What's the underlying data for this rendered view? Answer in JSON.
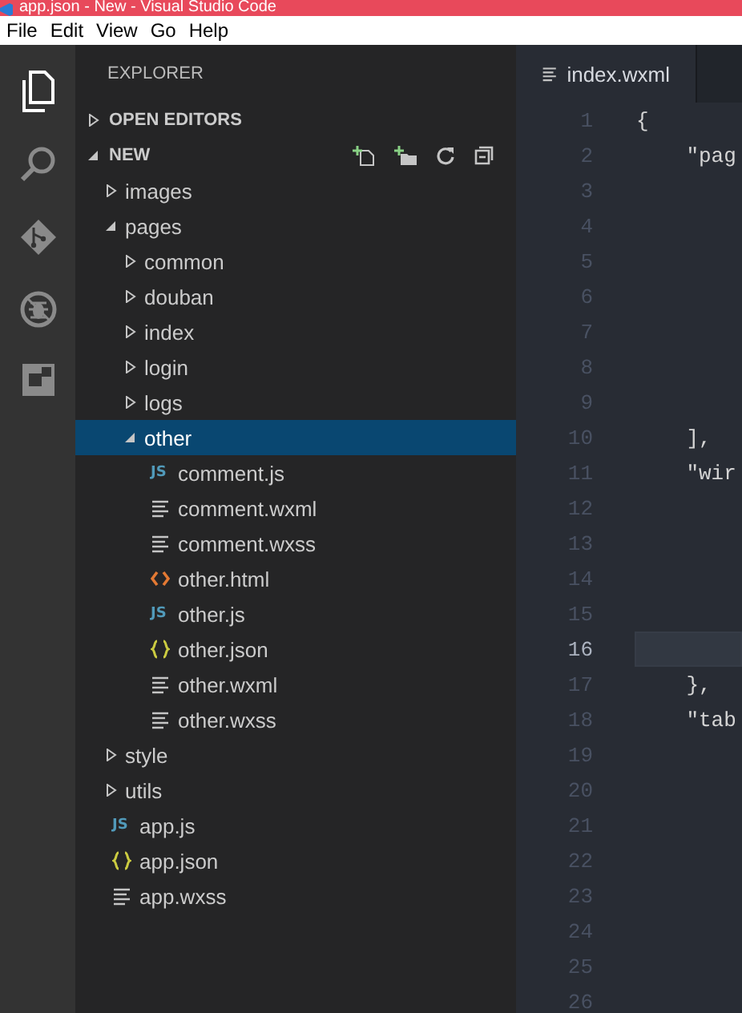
{
  "window": {
    "title": "app.json - New - Visual Studio Code"
  },
  "menu": [
    "File",
    "Edit",
    "View",
    "Go",
    "Help"
  ],
  "explorer": {
    "title": "EXPLORER",
    "sections": [
      {
        "label": "OPEN EDITORS",
        "expanded": false
      },
      {
        "label": "NEW",
        "expanded": true
      }
    ],
    "tree": [
      {
        "label": "images",
        "kind": "folder",
        "expanded": false,
        "selected": false
      },
      {
        "label": "pages",
        "kind": "folder",
        "expanded": true,
        "selected": false,
        "children": [
          {
            "label": "common",
            "kind": "folder",
            "expanded": false,
            "selected": false
          },
          {
            "label": "douban",
            "kind": "folder",
            "expanded": false,
            "selected": false
          },
          {
            "label": "index",
            "kind": "folder",
            "expanded": false,
            "selected": false
          },
          {
            "label": "login",
            "kind": "folder",
            "expanded": false,
            "selected": false
          },
          {
            "label": "logs",
            "kind": "folder",
            "expanded": false,
            "selected": false
          },
          {
            "label": "other",
            "kind": "folder",
            "expanded": true,
            "selected": true,
            "children": [
              {
                "label": "comment.js",
                "kind": "js",
                "icon": "JS",
                "selected": false
              },
              {
                "label": "comment.wxml",
                "kind": "text",
                "selected": false
              },
              {
                "label": "comment.wxss",
                "kind": "text",
                "selected": false
              },
              {
                "label": "other.html",
                "kind": "html",
                "selected": false
              },
              {
                "label": "other.js",
                "kind": "js",
                "icon": "JS",
                "selected": false
              },
              {
                "label": "other.json",
                "kind": "json",
                "selected": false
              },
              {
                "label": "other.wxml",
                "kind": "text",
                "selected": false
              },
              {
                "label": "other.wxss",
                "kind": "text",
                "selected": false
              }
            ]
          }
        ]
      },
      {
        "label": "style",
        "kind": "folder",
        "expanded": false,
        "selected": false
      },
      {
        "label": "utils",
        "kind": "folder",
        "expanded": false,
        "selected": false
      },
      {
        "label": "app.js",
        "kind": "js",
        "icon": "JS",
        "selected": false
      },
      {
        "label": "app.json",
        "kind": "json",
        "selected": false
      },
      {
        "label": "app.wxss",
        "kind": "text",
        "selected": false
      }
    ]
  },
  "editor": {
    "tabs": [
      {
        "label": "index.wxml",
        "kind": "text",
        "selected": true
      }
    ],
    "lines": [
      {
        "number": "1",
        "text": "{",
        "current": false
      },
      {
        "number": "2",
        "text": "    \"pag",
        "current": false
      },
      {
        "number": "3",
        "current": false
      },
      {
        "number": "4",
        "current": false
      },
      {
        "number": "5",
        "current": false
      },
      {
        "number": "6",
        "current": false
      },
      {
        "number": "7",
        "current": false
      },
      {
        "number": "8",
        "current": false
      },
      {
        "number": "9",
        "current": false
      },
      {
        "number": "10",
        "text": "    ],",
        "current": false
      },
      {
        "number": "11",
        "text": "    \"wir",
        "current": false
      },
      {
        "number": "12",
        "current": false
      },
      {
        "number": "13",
        "current": false
      },
      {
        "number": "14",
        "current": false
      },
      {
        "number": "15",
        "current": false
      },
      {
        "number": "16",
        "current": true
      },
      {
        "number": "17",
        "text": "    },",
        "current": false
      },
      {
        "number": "18",
        "text": "    \"tab",
        "current": false
      },
      {
        "number": "19",
        "current": false
      },
      {
        "number": "20",
        "current": false
      },
      {
        "number": "21",
        "current": false
      },
      {
        "number": "22",
        "current": false
      },
      {
        "number": "23",
        "current": false
      },
      {
        "number": "24",
        "current": false
      },
      {
        "number": "25",
        "current": false
      },
      {
        "number": "26",
        "current": false
      }
    ]
  }
}
